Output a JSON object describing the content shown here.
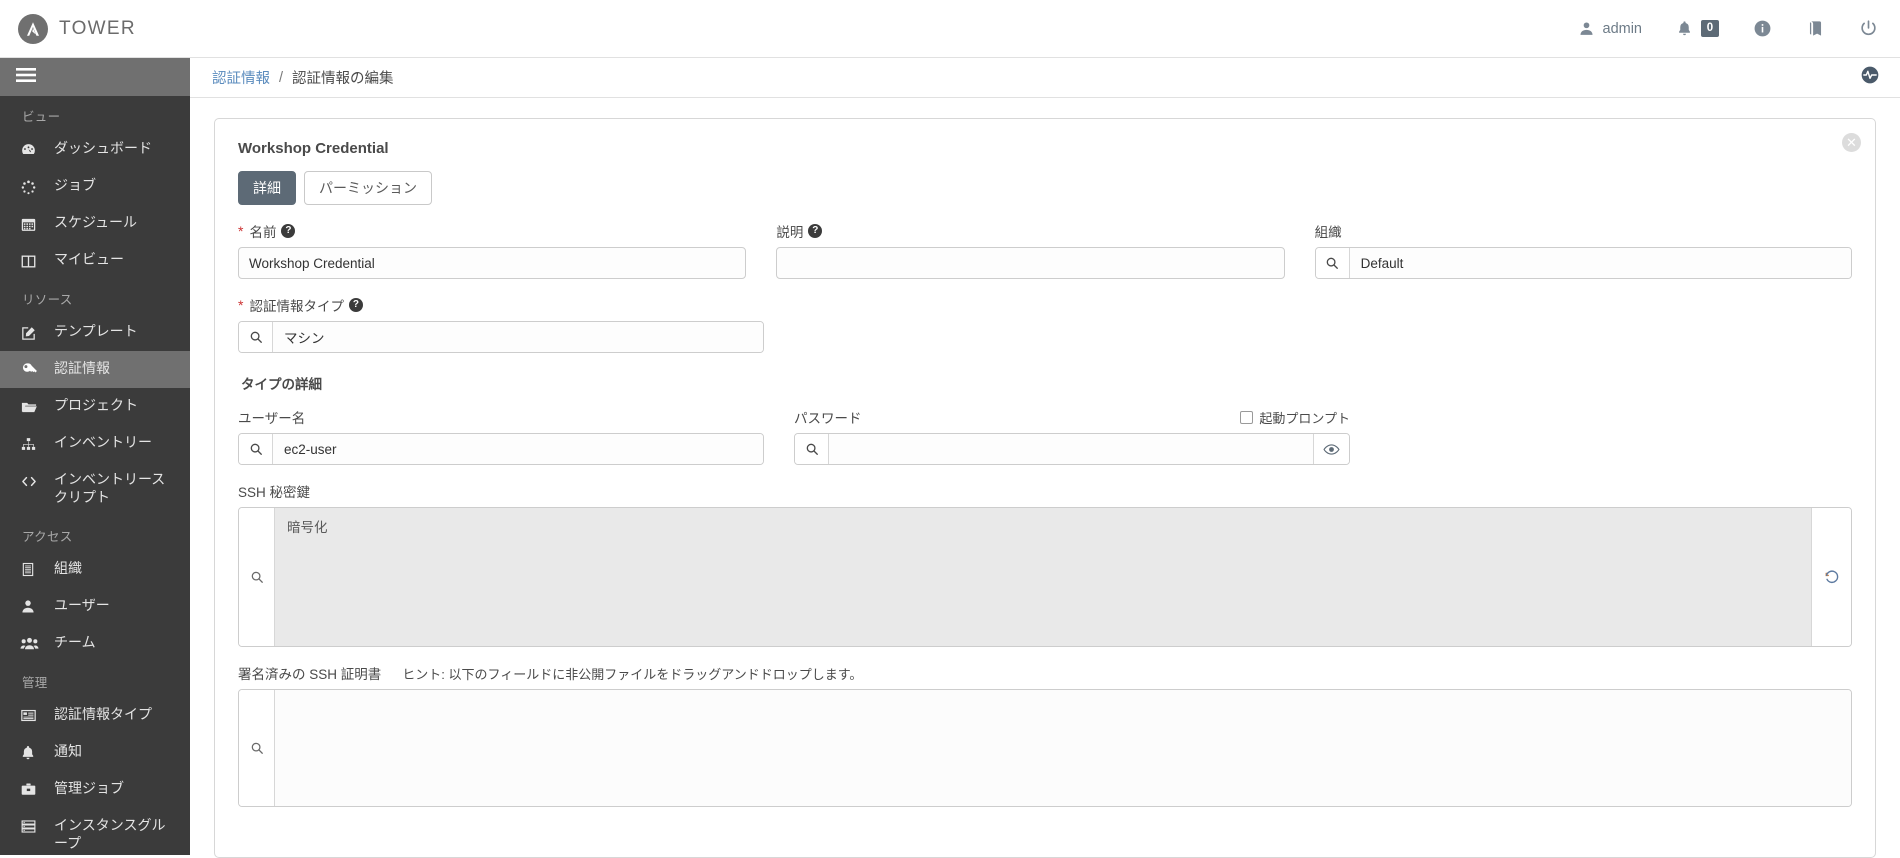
{
  "masthead": {
    "brand": "TOWER",
    "brand_icon": "ansible-logo-icon",
    "user": "admin",
    "notifications_count": "0",
    "items": [
      {
        "name": "user-menu",
        "icon": "user-icon",
        "label": "admin"
      },
      {
        "name": "notifications",
        "icon": "bell-icon",
        "label": "0"
      },
      {
        "name": "about",
        "icon": "info-icon",
        "label": ""
      },
      {
        "name": "documentation",
        "icon": "book-icon",
        "label": ""
      },
      {
        "name": "logout",
        "icon": "power-icon",
        "label": ""
      }
    ]
  },
  "sidebar": {
    "hamburger_icon": "hamburger-icon",
    "sections": [
      {
        "title": "ビュー",
        "items": [
          {
            "label": "ダッシュボード",
            "icon": "dashboard-icon",
            "key": "dashboard",
            "active": false
          },
          {
            "label": "ジョブ",
            "icon": "jobs-icon",
            "key": "jobs",
            "active": false
          },
          {
            "label": "スケジュール",
            "icon": "calendar-icon",
            "key": "schedules",
            "active": false
          },
          {
            "label": "マイビュー",
            "icon": "columns-icon",
            "key": "my-view",
            "active": false
          }
        ]
      },
      {
        "title": "リソース",
        "items": [
          {
            "label": "テンプレート",
            "icon": "template-edit-icon",
            "key": "templates",
            "active": false
          },
          {
            "label": "認証情報",
            "icon": "key-icon",
            "key": "credentials",
            "active": true
          },
          {
            "label": "プロジェクト",
            "icon": "folder-icon",
            "key": "projects",
            "active": false
          },
          {
            "label": "インベントリー",
            "icon": "sitemap-icon",
            "key": "inventories",
            "active": false
          },
          {
            "label": "インベントリースクリプト",
            "icon": "code-icon",
            "key": "inventory-scripts",
            "active": false
          }
        ]
      },
      {
        "title": "アクセス",
        "items": [
          {
            "label": "組織",
            "icon": "building-icon",
            "key": "organizations",
            "active": false
          },
          {
            "label": "ユーザー",
            "icon": "user-icon",
            "key": "users",
            "active": false
          },
          {
            "label": "チーム",
            "icon": "users-icon",
            "key": "teams",
            "active": false
          }
        ]
      },
      {
        "title": "管理",
        "items": [
          {
            "label": "認証情報タイプ",
            "icon": "id-card-icon",
            "key": "credential-types",
            "active": false
          },
          {
            "label": "通知",
            "icon": "bell-icon",
            "key": "notifications",
            "active": false
          },
          {
            "label": "管理ジョブ",
            "icon": "briefcase-icon",
            "key": "management-jobs",
            "active": false
          },
          {
            "label": "インスタンスグループ",
            "icon": "server-icon",
            "key": "instance-groups",
            "active": false
          }
        ]
      }
    ]
  },
  "breadcrumb": {
    "parent": "認証情報",
    "separator": "/",
    "current": "認証情報の編集",
    "activity_icon": "activity-stream-icon"
  },
  "card": {
    "title": "Workshop Credential",
    "close_icon": "close-icon",
    "tabs": [
      {
        "label": "詳細",
        "key": "details",
        "active": true
      },
      {
        "label": "パーミッション",
        "key": "permissions",
        "active": false
      }
    ]
  },
  "form": {
    "name": {
      "label": "名前",
      "required_marker": "*",
      "help_icon": "question-icon",
      "value": "Workshop Credential",
      "placeholder": ""
    },
    "description": {
      "label": "説明",
      "help_icon": "question-icon",
      "value": "",
      "placeholder": ""
    },
    "organization": {
      "label": "組織",
      "search_icon": "search-icon",
      "value": "Default",
      "placeholder": ""
    },
    "credential_type": {
      "label": "認証情報タイプ",
      "required_marker": "*",
      "help_icon": "question-icon",
      "search_icon": "search-icon",
      "value": "マシン",
      "placeholder": ""
    },
    "type_details_heading": "タイプの詳細",
    "username": {
      "label": "ユーザー名",
      "search_icon": "search-icon",
      "value": "ec2-user",
      "placeholder": ""
    },
    "password": {
      "label": "パスワード",
      "search_icon": "search-icon",
      "reveal_icon": "eye-icon",
      "value": "",
      "placeholder": "",
      "ask_label": "起動プロンプト",
      "ask_checked": false
    },
    "ssh_private_key": {
      "label": "SSH 秘密鍵",
      "search_icon": "search-icon",
      "revert_icon": "revert-icon",
      "value": "暗号化",
      "placeholder": ""
    },
    "signed_ssh_cert": {
      "label": "署名済みの SSH 証明書",
      "hint": "ヒント: 以下のフィールドに非公開ファイルをドラッグアンドドロップします。",
      "search_icon": "search-icon",
      "value": "",
      "placeholder": ""
    }
  },
  "colors": {
    "sidebar_bg": "#3b3b3b",
    "sidebar_active": "#707070",
    "accent_link": "#5a8bbd",
    "tab_active_bg": "#5d6a76",
    "required_star": "#cc3333",
    "encrypted_bg": "#e9e9e9"
  }
}
